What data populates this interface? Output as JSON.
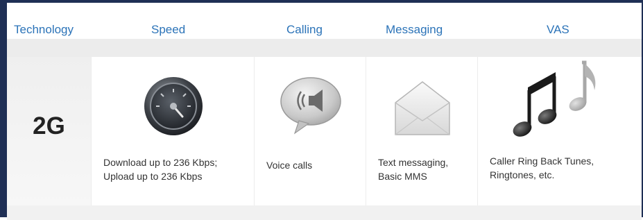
{
  "header": {
    "columns": [
      "Technology",
      "Speed",
      "Calling",
      "Messaging",
      "VAS"
    ]
  },
  "row": {
    "technology": "2G",
    "speed": {
      "icon": "speedometer-icon",
      "line1": "Download up to 236 Kbps;",
      "line2": "Upload up to 236 Kbps"
    },
    "calling": {
      "icon": "speaker-bubble-icon",
      "line1": "Voice calls"
    },
    "messaging": {
      "icon": "envelope-icon",
      "line1": "Text messaging,",
      "line2": "Basic MMS"
    },
    "vas": {
      "icon": "music-notes-icon",
      "line1": "Caller Ring Back Tunes,",
      "line2": "Ringtones, etc."
    }
  },
  "colors": {
    "frame": "#1f2f55",
    "header_text": "#2b73b8"
  }
}
